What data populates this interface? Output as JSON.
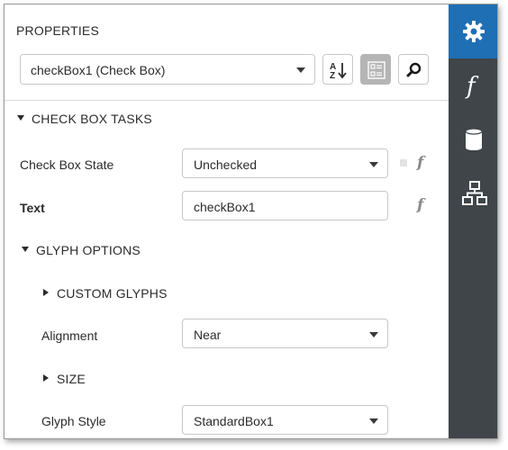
{
  "panel": {
    "title": "PROPERTIES",
    "object_selector": {
      "value": "checkBox1 (Check Box)"
    },
    "toolbar": {
      "sort_icon": "sort-alpha-icon",
      "categorize_icon": "categorized-icon",
      "search_icon": "search-icon"
    }
  },
  "sections": {
    "tasks": {
      "title": "CHECK BOX TASKS",
      "expanded": true
    },
    "glyph_options": {
      "title": "GLYPH OPTIONS",
      "expanded": true
    },
    "custom_glyphs": {
      "title": "CUSTOM GLYPHS",
      "expanded": false
    },
    "size": {
      "title": "SIZE",
      "expanded": false
    }
  },
  "properties": {
    "check_box_state": {
      "label": "Check Box State",
      "value": "Unchecked"
    },
    "text": {
      "label": "Text",
      "value": "checkBox1"
    },
    "alignment": {
      "label": "Alignment",
      "value": "Near"
    },
    "glyph_style": {
      "label": "Glyph Style",
      "value": "StandardBox1"
    }
  },
  "sidebar": {
    "tabs": [
      {
        "icon": "gear-icon",
        "active": true
      },
      {
        "icon": "function-icon",
        "active": false
      },
      {
        "icon": "database-icon",
        "active": false
      },
      {
        "icon": "hierarchy-icon",
        "active": false
      }
    ]
  },
  "colors": {
    "accent": "#1f6fb5",
    "sidebar_bg": "#3f4549",
    "active_button": "#b5b5b5"
  }
}
